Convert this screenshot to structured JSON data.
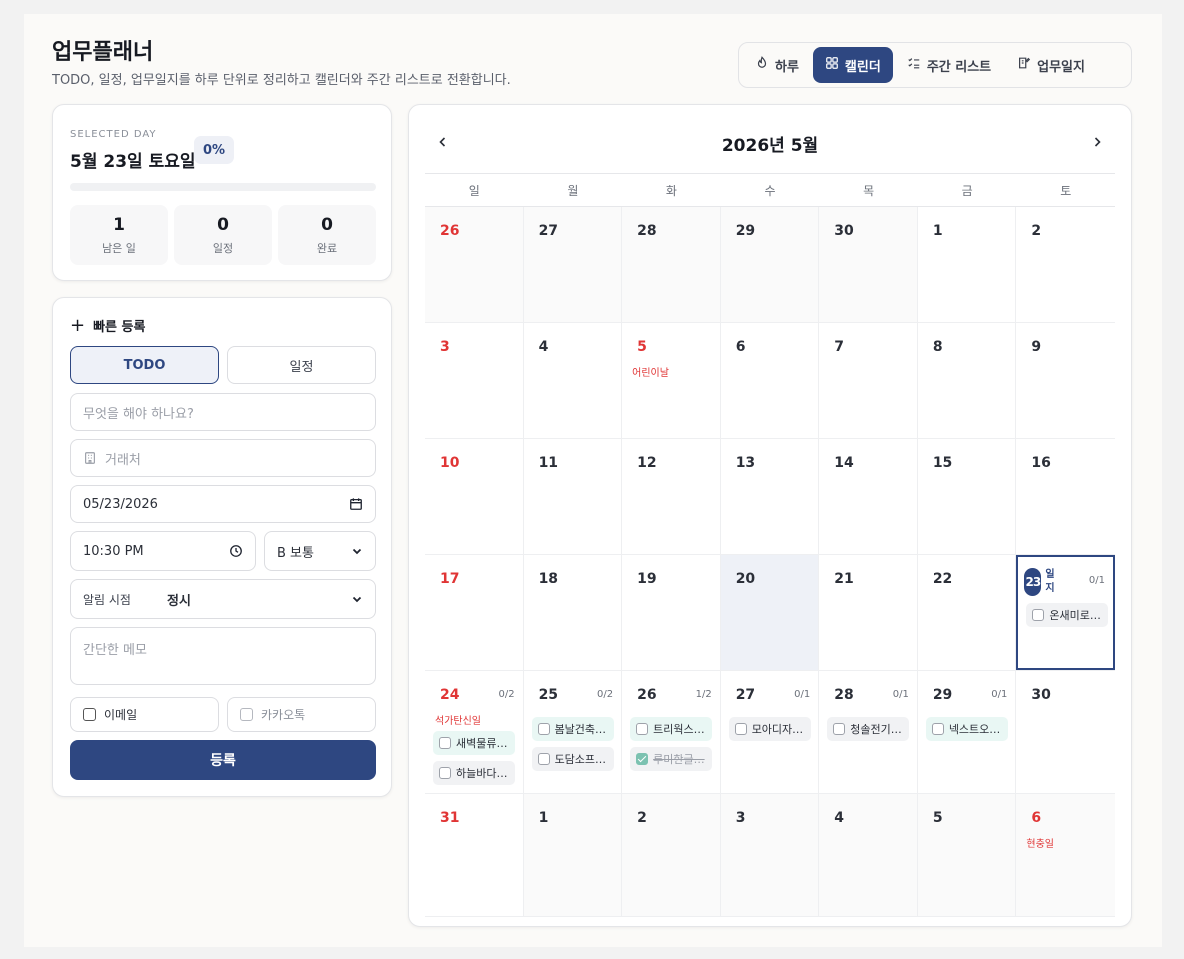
{
  "header": {
    "title": "업무플래너",
    "subtitle": "TODO, 일정, 업무일지를 하루 단위로 정리하고 캘린더와 주간 리스트로 전환합니다."
  },
  "view_tabs": [
    {
      "label": "하루",
      "icon": "flame-icon",
      "active": false
    },
    {
      "label": "캘린더",
      "icon": "grid-icon",
      "active": true
    },
    {
      "label": "주간 리스트",
      "icon": "checklist-icon",
      "active": false
    },
    {
      "label": "업무일지",
      "icon": "notebook-icon",
      "active": false
    }
  ],
  "day_summary": {
    "label": "SELECTED DAY",
    "date": "5월 23일 토요일",
    "percent": "0%",
    "progress": 0,
    "stats": [
      {
        "value": "1",
        "label": "남은 일"
      },
      {
        "value": "0",
        "label": "일정"
      },
      {
        "value": "0",
        "label": "완료"
      }
    ]
  },
  "quick_add": {
    "title": "빠른 등록",
    "types": [
      "TODO",
      "일정"
    ],
    "active_type": "TODO",
    "task_placeholder": "무엇을 해야 하나요?",
    "client_placeholder": "거래처",
    "date_value": "05/23/2026",
    "time_value": "10:30 PM",
    "priority_value": "B 보통",
    "alarm_label": "알림 시점",
    "alarm_value": "정시",
    "memo_placeholder": "간단한 메모",
    "email_label": "이메일",
    "kakao_label": "카카오톡",
    "submit_label": "등록"
  },
  "calendar": {
    "title": "2026년 5월",
    "weekdays": [
      "일",
      "월",
      "화",
      "수",
      "목",
      "금",
      "토"
    ],
    "weeks": [
      [
        {
          "day": "26",
          "out": true
        },
        {
          "day": "27",
          "out": true
        },
        {
          "day": "28",
          "out": true
        },
        {
          "day": "29",
          "out": true
        },
        {
          "day": "30",
          "out": true
        },
        {
          "day": "1"
        },
        {
          "day": "2"
        }
      ],
      [
        {
          "day": "3"
        },
        {
          "day": "4"
        },
        {
          "day": "5",
          "holiday": "어린이날"
        },
        {
          "day": "6"
        },
        {
          "day": "7"
        },
        {
          "day": "8"
        },
        {
          "day": "9"
        }
      ],
      [
        {
          "day": "10"
        },
        {
          "day": "11"
        },
        {
          "day": "12"
        },
        {
          "day": "13"
        },
        {
          "day": "14"
        },
        {
          "day": "15"
        },
        {
          "day": "16"
        }
      ],
      [
        {
          "day": "17"
        },
        {
          "day": "18"
        },
        {
          "day": "19"
        },
        {
          "day": "20",
          "today": true
        },
        {
          "day": "21"
        },
        {
          "day": "22"
        },
        {
          "day": "23",
          "selected": true,
          "tag": "일지",
          "count": "0/1",
          "items": [
            {
              "text": "온새미로…",
              "style": "gray"
            }
          ]
        }
      ],
      [
        {
          "day": "24",
          "count": "0/2",
          "holiday": "석가탄신일",
          "items": [
            {
              "text": "새벽물류…",
              "style": "teal"
            },
            {
              "text": "하늘바다…",
              "style": "gray"
            }
          ]
        },
        {
          "day": "25",
          "count": "0/2",
          "items": [
            {
              "text": "봄날건축…",
              "style": "teal"
            },
            {
              "text": "도담소프…",
              "style": "gray"
            }
          ]
        },
        {
          "day": "26",
          "count": "1/2",
          "items": [
            {
              "text": "트리웍스…",
              "style": "teal"
            },
            {
              "text": "루미한글…",
              "style": "gray",
              "done": true
            }
          ]
        },
        {
          "day": "27",
          "count": "0/1",
          "items": [
            {
              "text": "모아디자…",
              "style": "gray"
            }
          ]
        },
        {
          "day": "28",
          "count": "0/1",
          "items": [
            {
              "text": "청솔전기…",
              "style": "gray"
            }
          ]
        },
        {
          "day": "29",
          "count": "0/1",
          "items": [
            {
              "text": "넥스트오…",
              "style": "teal"
            }
          ]
        },
        {
          "day": "30"
        }
      ],
      [
        {
          "day": "31"
        },
        {
          "day": "1",
          "out": true
        },
        {
          "day": "2",
          "out": true
        },
        {
          "day": "3",
          "out": true
        },
        {
          "day": "4",
          "out": true
        },
        {
          "day": "5",
          "out": true
        },
        {
          "day": "6",
          "out": true,
          "holiday": "현충일",
          "red": true
        }
      ]
    ]
  },
  "colors": {
    "accent": "#2e4781",
    "holiday": "#e03535",
    "teal_item": "#e9f7f4"
  }
}
